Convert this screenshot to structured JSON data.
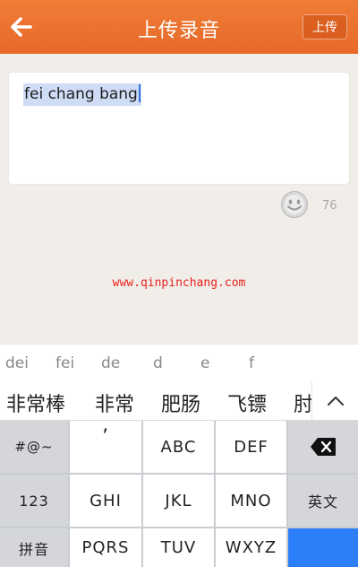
{
  "header": {
    "title": "上传录音",
    "upload_label": "上传"
  },
  "editor": {
    "input_value": "fei chang bang",
    "char_count": "76"
  },
  "watermark": "www.qinpinchang.com",
  "keyboard": {
    "pinyin_suggestions": [
      "dei",
      "fei",
      "de",
      "d",
      "e",
      "f"
    ],
    "candidates": [
      "非常棒",
      "非常",
      "肥肠",
      "飞镖",
      "肘"
    ],
    "rows": [
      [
        "#@~",
        "’",
        "ABC",
        "DEF",
        "⌫"
      ],
      [
        "123",
        "GHI",
        "JKL",
        "MNO",
        "英文"
      ],
      [
        "拼音",
        "PQRS",
        "TUV",
        "WXYZ",
        ""
      ]
    ]
  },
  "colors": {
    "header": "#ea7230",
    "confirm_key": "#2d7ff9",
    "watermark": "#e8201e"
  }
}
